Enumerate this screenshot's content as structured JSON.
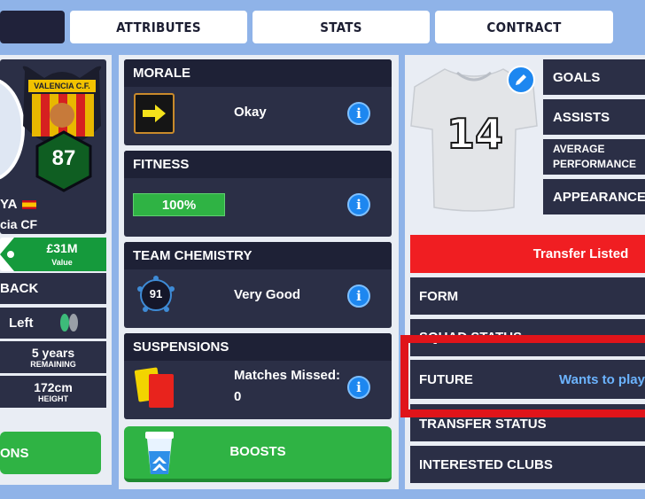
{
  "tabs": [
    {
      "label": ""
    },
    {
      "label": "ATTRIBUTES"
    },
    {
      "label": "STATS"
    },
    {
      "label": "CONTRACT"
    }
  ],
  "player": {
    "club_badge": "VALENCIA C.F.",
    "rating": "87",
    "name_fragment": "YA",
    "club_fragment": "cia CF",
    "value": "£31M",
    "value_label": "Value",
    "position_fragment": "BACK",
    "foot": "Left",
    "contract_years": "5 years",
    "contract_label": "REMAINING",
    "height": "172cm",
    "height_label": "HEIGHT",
    "left_button_fragment": "ONS"
  },
  "middle": {
    "morale": {
      "title": "MORALE",
      "value": "Okay"
    },
    "fitness": {
      "title": "FITNESS",
      "value": "100%"
    },
    "chemistry": {
      "title": "TEAM CHEMISTRY",
      "value": "Very Good",
      "score": "91"
    },
    "suspensions": {
      "title": "SUSPENSIONS",
      "label": "Matches Missed:",
      "value": "0"
    },
    "boosts_label": "BOOSTS"
  },
  "shirt_number": "14",
  "right_stats": [
    "GOALS",
    "ASSISTS",
    "AVERAGE PERFORMANCE",
    "APPEARANCES"
  ],
  "status_rows": {
    "transfer_listed": "Transfer Listed",
    "form": "FORM",
    "squad_status": "SQUAD STATUS",
    "future": "FUTURE",
    "future_value": "Wants to play f",
    "transfer_status": "TRANSFER STATUS",
    "interested_clubs": "INTERESTED CLUBS"
  },
  "colors": {
    "background": "#8fb3e8",
    "card": "#2b2f46",
    "card_header": "#1e2136",
    "accent_green": "#2fb344",
    "transfer_red": "#f01e22",
    "highlight_box": "#e0141a",
    "info_blue": "#1d87f0"
  },
  "icons": {
    "info": "i",
    "morale_arrow": "➜",
    "edit": "pencil-icon"
  }
}
